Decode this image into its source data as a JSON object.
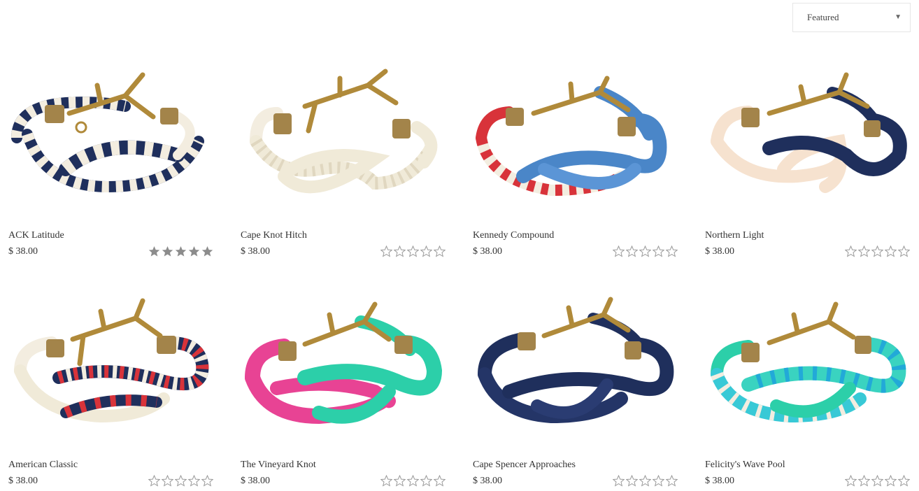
{
  "sort": {
    "selected": "Featured",
    "caret": "▼"
  },
  "colors": {
    "star_filled": "#8c8c8c",
    "star_empty_stroke": "#9a9a9a",
    "brass": "#b08a3a",
    "navy": "#1f2f5c",
    "cream": "#f3ede0",
    "red": "#d8333a",
    "blue": "#4a86c8",
    "pink": "#e84394",
    "teal": "#2ccfa9",
    "turquoise": "#38c9d6",
    "peach": "#f6e2cf"
  },
  "products": [
    {
      "name": "ACK Latitude",
      "price": "$ 38.00",
      "rating": 5,
      "icon": "bracelet-image"
    },
    {
      "name": "Cape Knot Hitch",
      "price": "$ 38.00",
      "rating": 0,
      "icon": "bracelet-image"
    },
    {
      "name": "Kennedy Compound",
      "price": "$ 38.00",
      "rating": 0,
      "icon": "bracelet-image"
    },
    {
      "name": "Northern Light",
      "price": "$ 38.00",
      "rating": 0,
      "icon": "bracelet-image"
    },
    {
      "name": "American Classic",
      "price": "$ 38.00",
      "rating": 0,
      "icon": "bracelet-image"
    },
    {
      "name": "The Vineyard Knot",
      "price": "$ 38.00",
      "rating": 0,
      "icon": "bracelet-image"
    },
    {
      "name": "Cape Spencer Approaches",
      "price": "$ 38.00",
      "rating": 0,
      "icon": "bracelet-image"
    },
    {
      "name": "Felicity's Wave Pool",
      "price": "$ 38.00",
      "rating": 0,
      "icon": "bracelet-image"
    }
  ]
}
